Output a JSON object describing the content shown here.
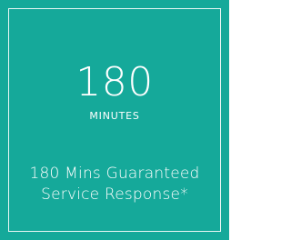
{
  "card": {
    "number": "180",
    "unit": "MINUTES",
    "description_line1": "180 Mins Guaranteed",
    "description_line2": "Service Response*"
  },
  "colors": {
    "background": "#15a99a",
    "text": "#ffffff",
    "border": "#ffffff"
  }
}
